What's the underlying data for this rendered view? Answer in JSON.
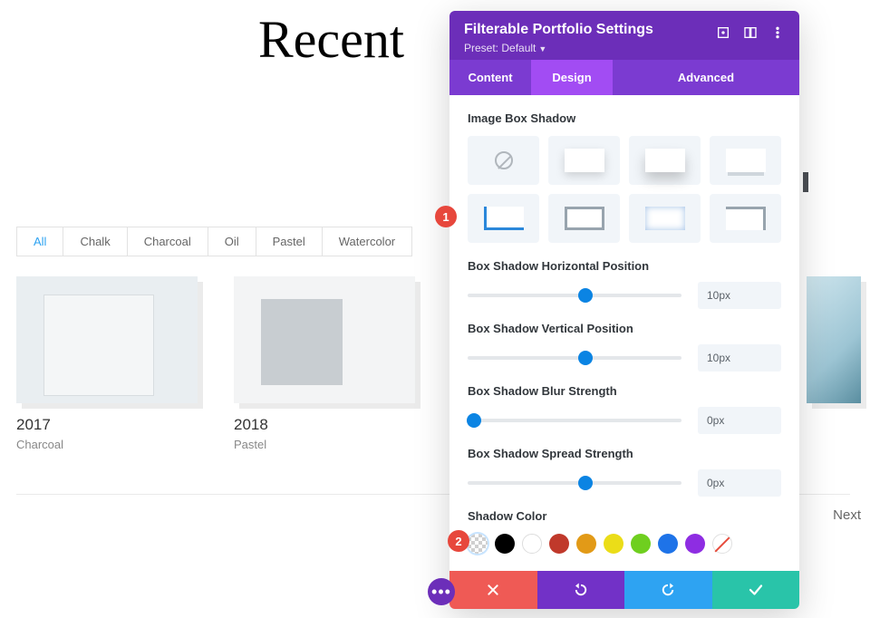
{
  "page": {
    "title": "Recent"
  },
  "filters": {
    "items": [
      {
        "label": "All"
      },
      {
        "label": "Chalk"
      },
      {
        "label": "Charcoal"
      },
      {
        "label": "Oil"
      },
      {
        "label": "Pastel"
      },
      {
        "label": "Watercolor"
      }
    ],
    "active_index": 0
  },
  "gallery": {
    "items": [
      {
        "year": "2017",
        "category": "Charcoal"
      },
      {
        "year": "2018",
        "category": "Pastel"
      }
    ]
  },
  "pagination": {
    "next_label": "Next"
  },
  "panel": {
    "title": "Filterable Portfolio Settings",
    "preset_label": "Preset: Default",
    "tabs": {
      "content": "Content",
      "design": "Design",
      "advanced": "Advanced",
      "active": "design"
    }
  },
  "sections": {
    "image_box_shadow": "Image Box Shadow",
    "horizontal": {
      "label": "Box Shadow Horizontal Position",
      "value": "10px",
      "pos_pct": 55
    },
    "vertical": {
      "label": "Box Shadow Vertical Position",
      "value": "10px",
      "pos_pct": 55
    },
    "blur": {
      "label": "Box Shadow Blur Strength",
      "value": "0px",
      "pos_pct": 3
    },
    "spread": {
      "label": "Box Shadow Spread Strength",
      "value": "0px",
      "pos_pct": 55
    },
    "shadow_color": {
      "label": "Shadow Color"
    }
  },
  "swatch_colors": {
    "black": "#000000",
    "white": "#ffffff",
    "red": "#c0392b",
    "orange": "#e29a17",
    "yellow": "#ebdd18",
    "green": "#6fcf1f",
    "blue": "#1e73e8",
    "purple": "#8e2de2"
  },
  "annotations": {
    "step1": "1",
    "step2": "2"
  }
}
